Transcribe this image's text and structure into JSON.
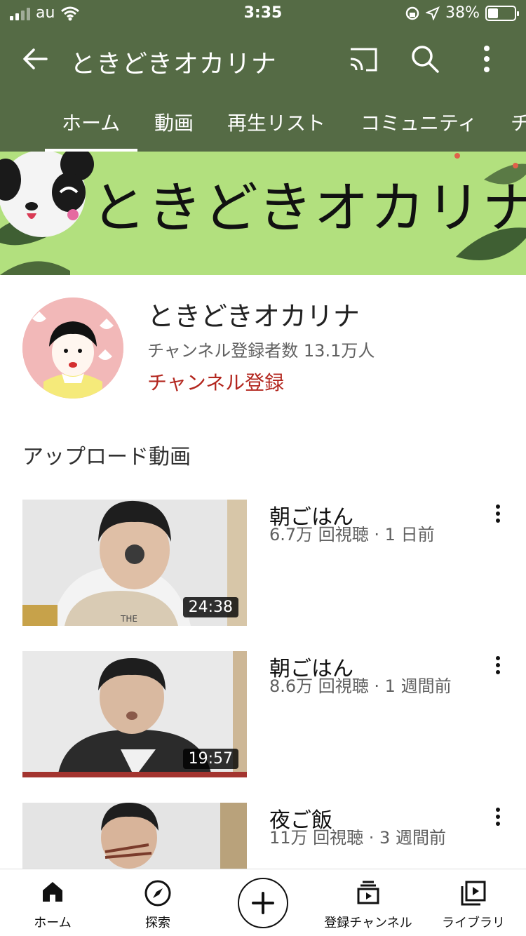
{
  "status_bar": {
    "carrier": "au",
    "time": "3:35",
    "battery": "38%",
    "battery_level": 0.38
  },
  "header": {
    "title": "ときどきオカリナ"
  },
  "tabs": [
    {
      "label": "ホーム",
      "selected": true
    },
    {
      "label": "動画"
    },
    {
      "label": "再生リスト"
    },
    {
      "label": "コミュニティ"
    },
    {
      "label": "チ"
    }
  ],
  "banner": {
    "text": "ときどきオカリナ"
  },
  "channel": {
    "name": "ときどきオカリナ",
    "subscribers": "チャンネル登録者数 13.1万人",
    "subscribe_label": "チャンネル登録"
  },
  "section": {
    "title": "アップロード動画"
  },
  "videos": [
    {
      "title": "朝ごはん",
      "meta": "6.7万 回視聴 · 1 日前",
      "duration": "24:38"
    },
    {
      "title": "朝ごはん",
      "meta": "8.6万 回視聴 · 1 週間前",
      "duration": "19:57"
    },
    {
      "title": "夜ご飯",
      "meta": "11万 回視聴 · 3 週間前",
      "duration": ""
    }
  ],
  "bottom_nav": [
    {
      "label": "ホーム",
      "icon": "home-icon"
    },
    {
      "label": "探索",
      "icon": "explore-icon"
    },
    {
      "label": "",
      "icon": "create-icon"
    },
    {
      "label": "登録チャンネル",
      "icon": "subscriptions-icon"
    },
    {
      "label": "ライブラリ",
      "icon": "library-icon"
    }
  ]
}
